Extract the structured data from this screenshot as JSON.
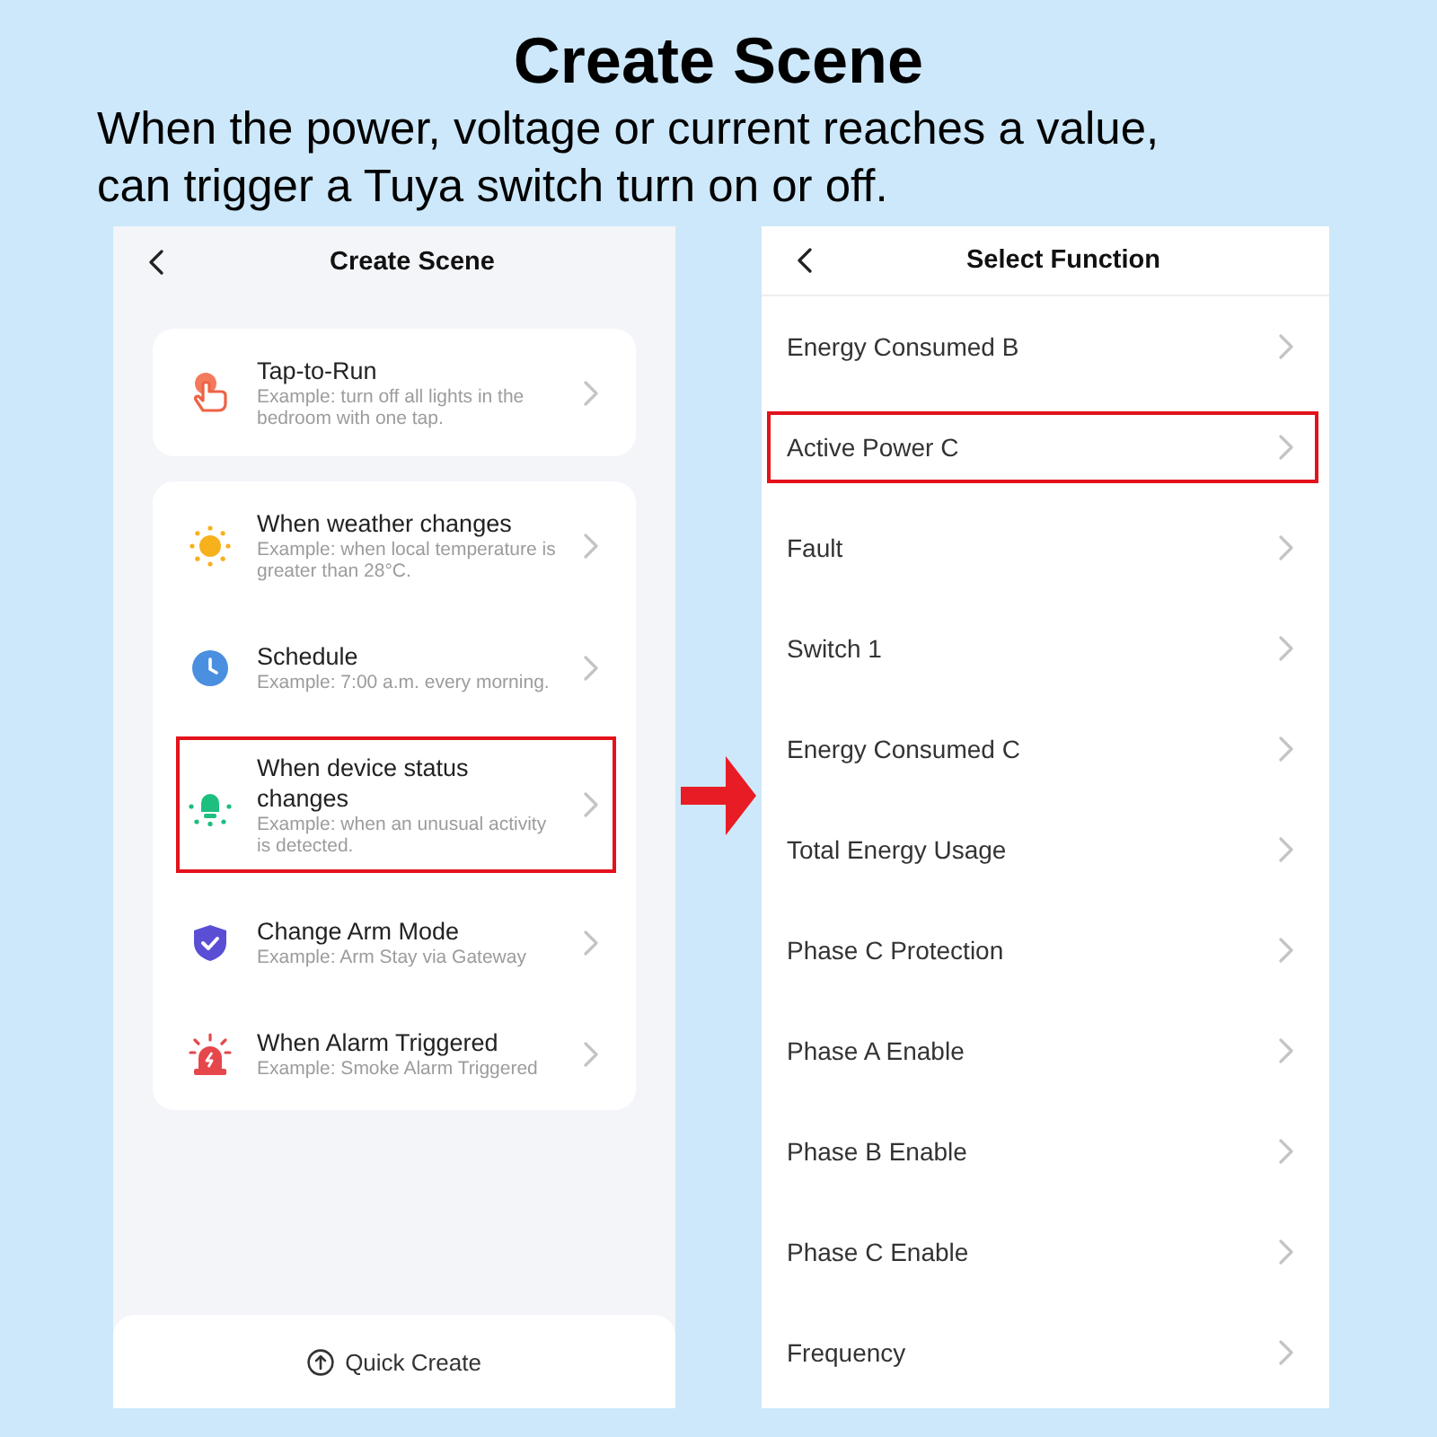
{
  "header": {
    "title": "Create Scene",
    "subtitle": "When the power, voltage or current reaches a value,\ncan trigger a Tuya switch turn on or off."
  },
  "left_screen": {
    "title": "Create Scene",
    "cards": [
      {
        "items": [
          {
            "kind": "tap",
            "title": "Tap-to-Run",
            "description": "Example: turn off all lights in the\nbedroom with one tap.",
            "highlighted": false
          }
        ]
      },
      {
        "items": [
          {
            "kind": "weather",
            "title": "When weather changes",
            "description": "Example: when local temperature is\ngreater than 28°C.",
            "highlighted": false
          },
          {
            "kind": "schedule",
            "title": "Schedule",
            "description": "Example: 7:00 a.m. every morning.",
            "highlighted": false
          },
          {
            "kind": "device",
            "title": "When device status\nchanges",
            "description": "Example: when an unusual activity\nis detected.",
            "highlighted": true
          },
          {
            "kind": "arm",
            "title": "Change Arm Mode",
            "description": "Example: Arm Stay via Gateway",
            "highlighted": false
          },
          {
            "kind": "alarm",
            "title": "When Alarm Triggered",
            "description": "Example: Smoke Alarm Triggered",
            "highlighted": false
          }
        ]
      }
    ],
    "quick_create": {
      "label": "Quick Create"
    }
  },
  "right_screen": {
    "title": "Select Function",
    "items": [
      {
        "label": "Energy Consumed B",
        "highlighted": false
      },
      {
        "label": "Active Power C",
        "highlighted": true
      },
      {
        "label": "Fault",
        "highlighted": false
      },
      {
        "label": "Switch 1",
        "highlighted": false
      },
      {
        "label": "Energy Consumed C",
        "highlighted": false
      },
      {
        "label": "Total Energy Usage",
        "highlighted": false
      },
      {
        "label": "Phase C Protection",
        "highlighted": false
      },
      {
        "label": "Phase A Enable",
        "highlighted": false
      },
      {
        "label": "Phase B Enable",
        "highlighted": false
      },
      {
        "label": "Phase C Enable",
        "highlighted": false
      },
      {
        "label": "Frequency",
        "highlighted": false
      }
    ]
  }
}
